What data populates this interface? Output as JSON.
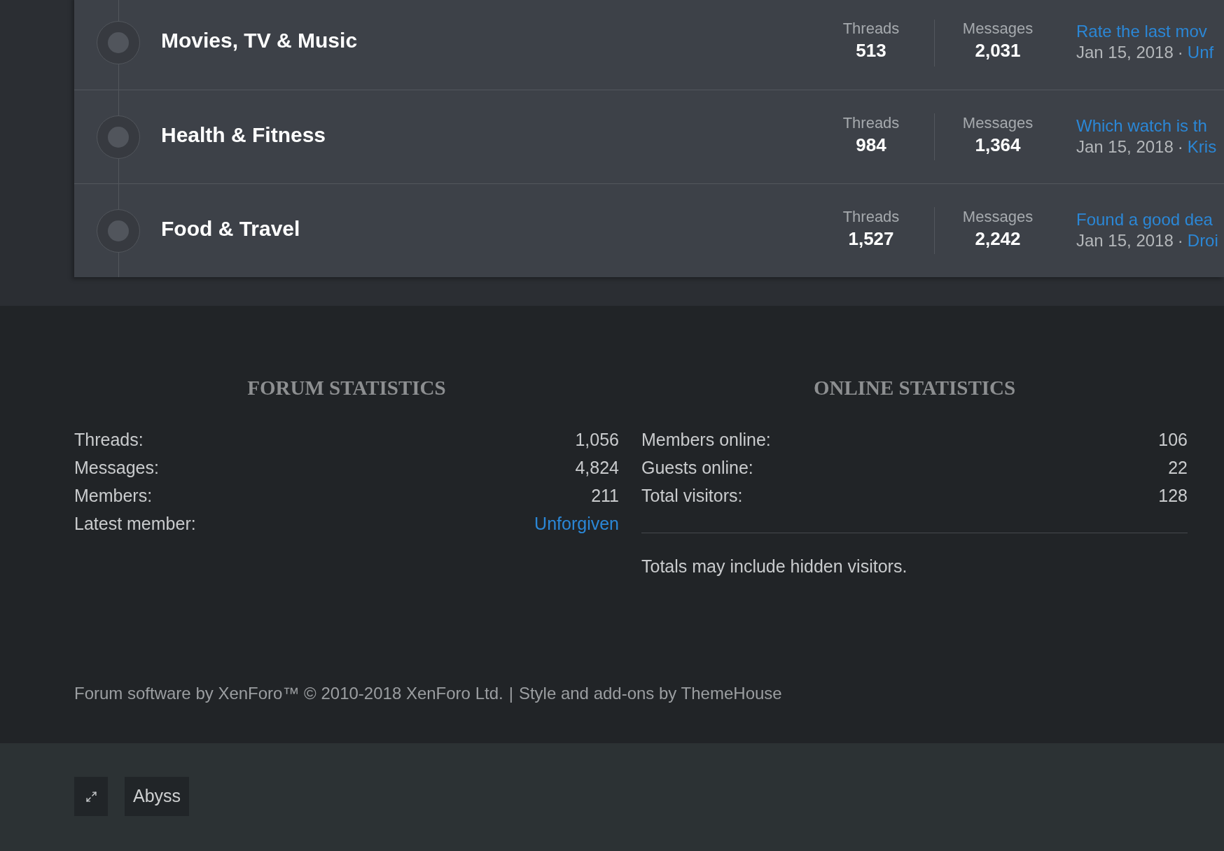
{
  "forums": [
    {
      "title": "Movies, TV & Music",
      "stats": [
        {
          "label": "Threads",
          "value": "513"
        },
        {
          "label": "Messages",
          "value": "2,031"
        }
      ],
      "latest": {
        "title": "Rate the last mov",
        "date": "Jan 15, 2018",
        "separator": "·",
        "user": "Unf"
      }
    },
    {
      "title": "Health & Fitness",
      "stats": [
        {
          "label": "Threads",
          "value": "984"
        },
        {
          "label": "Messages",
          "value": "1,364"
        }
      ],
      "latest": {
        "title": "Which watch is th",
        "date": "Jan 15, 2018",
        "separator": "·",
        "user": "Kris"
      }
    },
    {
      "title": "Food & Travel",
      "stats": [
        {
          "label": "Threads",
          "value": "1,527"
        },
        {
          "label": "Messages",
          "value": "2,242"
        }
      ],
      "latest": {
        "title": "Found a good dea",
        "date": "Jan 15, 2018",
        "separator": "·",
        "user": "Droi"
      }
    }
  ],
  "footer": {
    "forum_statistics": {
      "title": "FORUM STATISTICS",
      "rows": [
        {
          "label": "Threads:",
          "value": "1,056",
          "kind": "text"
        },
        {
          "label": "Messages:",
          "value": "4,824",
          "kind": "text"
        },
        {
          "label": "Members:",
          "value": "211",
          "kind": "text"
        },
        {
          "label": "Latest member:",
          "value": "Unforgiven",
          "kind": "link"
        }
      ]
    },
    "online_statistics": {
      "title": "ONLINE STATISTICS",
      "rows": [
        {
          "label": "Members online:",
          "value": "106",
          "kind": "text"
        },
        {
          "label": "Guests online:",
          "value": "22",
          "kind": "text"
        },
        {
          "label": "Total visitors:",
          "value": "128",
          "kind": "text"
        }
      ],
      "note": "Totals may include hidden visitors."
    },
    "copyright": {
      "software_credit": "Forum software by XenForo™ © 2010-2018 XenForo Ltd.",
      "separator": "|",
      "style_credit": "Style and add-ons by ThemeHouse"
    }
  },
  "bottom_bar": {
    "buttons": [
      {
        "kind": "icon"
      },
      {
        "kind": "text",
        "label": "Abyss"
      }
    ]
  }
}
